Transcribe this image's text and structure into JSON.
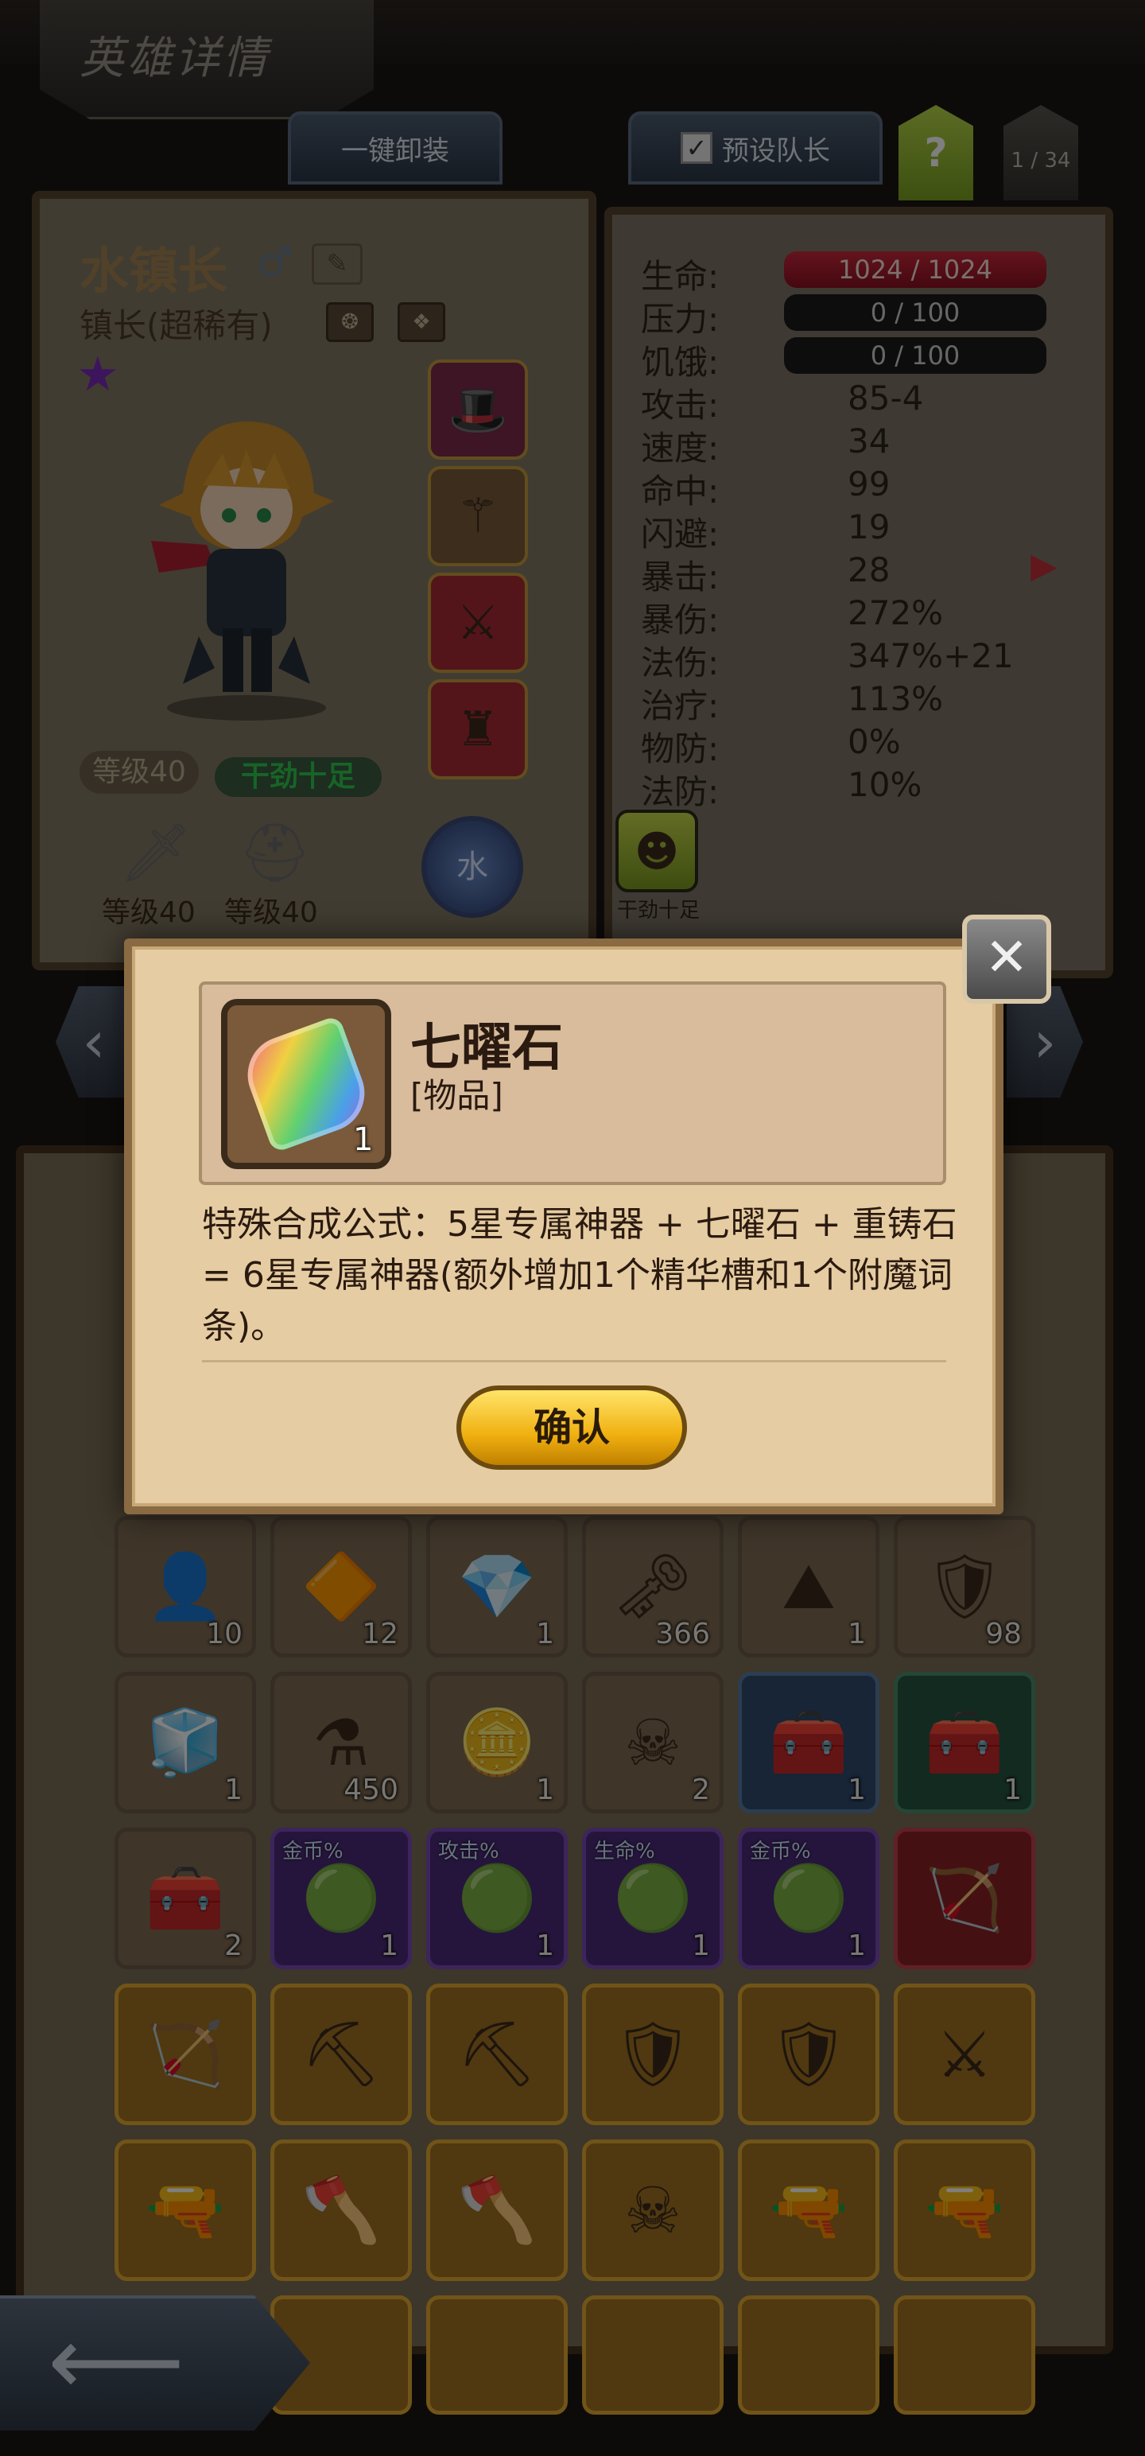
{
  "header": {
    "title": "英雄详情"
  },
  "toolbar": {
    "unequip_label": "一键卸装",
    "preset_label": "预设队长",
    "preset_checked": "✓",
    "help_label": "?",
    "page_count": "1 / 34"
  },
  "hero": {
    "name": "水镇长",
    "class": "镇长(超稀有)",
    "level": "等级40",
    "mood": "干劲十足",
    "weapon_level": "等级40",
    "armor_level": "等级40",
    "element": "水"
  },
  "stats": [
    {
      "label": "生命:",
      "value": "1024 / 1024"
    },
    {
      "label": "压力:",
      "value": "0 / 100"
    },
    {
      "label": "饥饿:",
      "value": "0 / 100"
    },
    {
      "label": "攻击:",
      "value": "85-4"
    },
    {
      "label": "速度:",
      "value": "34"
    },
    {
      "label": "命中:",
      "value": "99"
    },
    {
      "label": "闪避:",
      "value": "19"
    },
    {
      "label": "暴击:",
      "value": "28"
    },
    {
      "label": "暴伤:",
      "value": "272%"
    },
    {
      "label": "法伤:",
      "value": "347%+21"
    },
    {
      "label": "治疗:",
      "value": "113%"
    },
    {
      "label": "物防:",
      "value": "0%"
    },
    {
      "label": "法防:",
      "value": "10%"
    }
  ],
  "trait": {
    "label": "干劲十足"
  },
  "inventory": {
    "rows": [
      [
        {
          "count": "10"
        },
        {
          "count": "12"
        },
        {
          "count": "1"
        },
        {
          "count": "366"
        },
        {
          "count": "1"
        },
        {
          "count": "98"
        }
      ],
      [
        {
          "count": "1"
        },
        {
          "count": "450"
        },
        {
          "count": "1"
        },
        {
          "count": "2"
        },
        {
          "count": "1"
        },
        {
          "count": "1"
        }
      ],
      [
        {
          "count": "2"
        },
        {
          "count": "1",
          "tag": "金币%"
        },
        {
          "count": "1",
          "tag": "攻击%"
        },
        {
          "count": "1",
          "tag": "生命%"
        },
        {
          "count": "1",
          "tag": "金币%"
        },
        {
          "count": ""
        }
      ]
    ]
  },
  "modal": {
    "item_name": "七曜石",
    "item_type": "[物品]",
    "item_count": "1",
    "description": "特殊合成公式：5星专属神器 + 七曜石 + 重铸石 = 6星专属神器(额外增加1个精华槽和1个附魔词条)。",
    "confirm_label": "确认"
  }
}
